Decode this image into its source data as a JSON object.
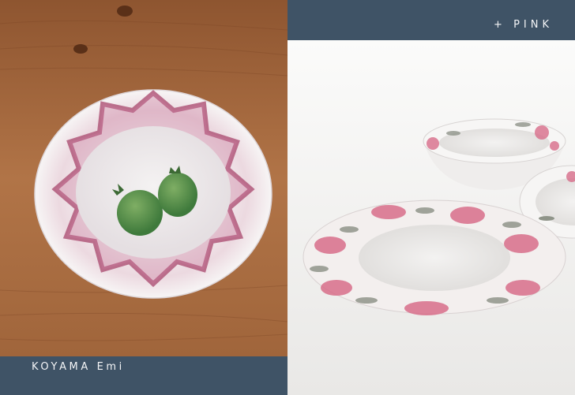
{
  "left_panel": {
    "caption": "KOYAMA  Emi",
    "image_name": "pink-lotus-plate-with-feijoas"
  },
  "right_panel": {
    "header": "+  PINK",
    "image_name": "pink-flower-pattern-bowls"
  },
  "colors": {
    "bar": "#3f5366",
    "bar_text": "#f3f4f6",
    "wood": "#a5683e",
    "pink": "#c46a8a",
    "studio_bg": "#f2f2f0"
  }
}
